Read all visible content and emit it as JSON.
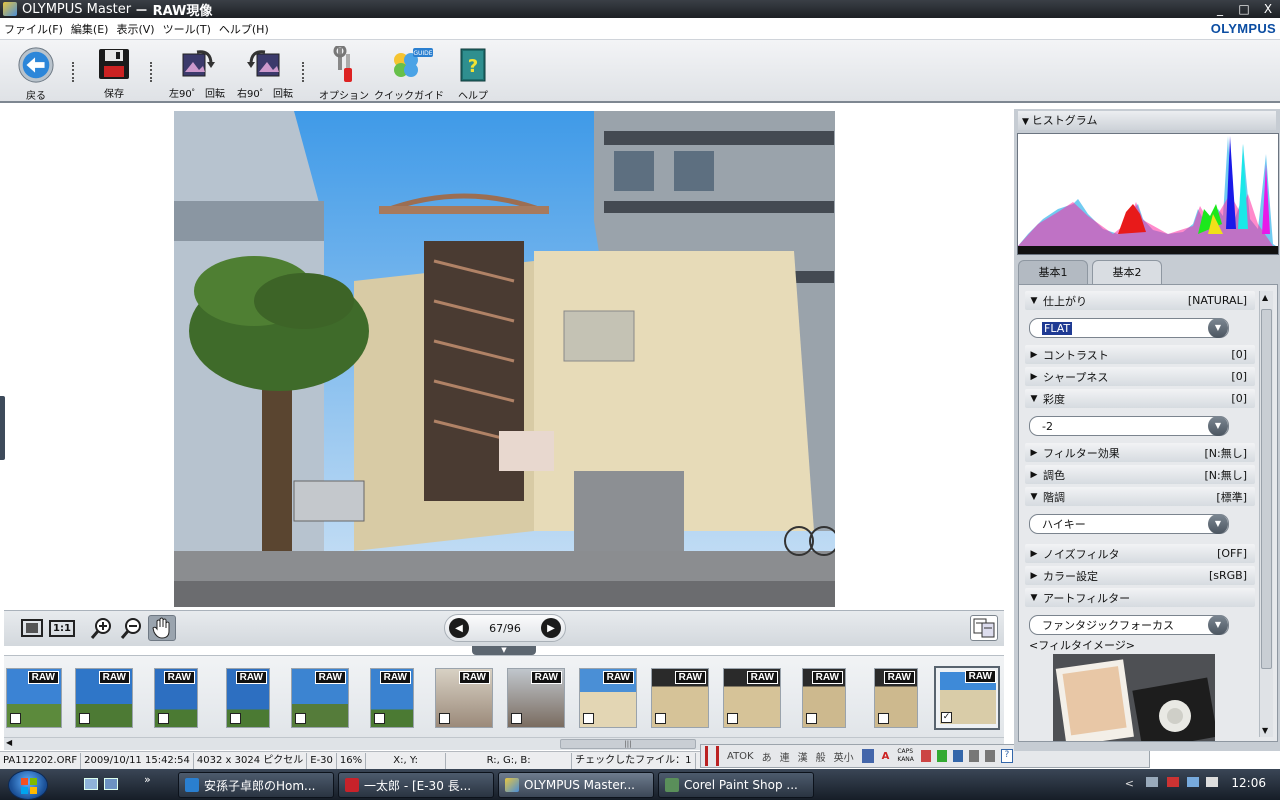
{
  "window": {
    "title": "OLYMPUS Master",
    "subtitle": "－ RAW現像",
    "controls": [
      "_",
      "□",
      "X"
    ]
  },
  "menu": {
    "items": [
      "ファイル(F)",
      "編集(E)",
      "表示(V)",
      "ツール(T)",
      "ヘルプ(H)"
    ],
    "brand": "OLYMPUS"
  },
  "toolbar": {
    "back": "戻る",
    "save": "保存",
    "rotate_left": "左90゜ 回転",
    "rotate_right": "右90゜ 回転",
    "options": "オプション",
    "quick_guide": "クイックガイド",
    "quick_guide_badge": "GUIDE",
    "help": "ヘルプ"
  },
  "viewbar": {
    "page_counter": "67/96",
    "ratio_label": "1:1"
  },
  "filmstrip": {
    "badge": "RAW",
    "thumbs": [
      {
        "checked": false
      },
      {
        "checked": false
      },
      {
        "checked": false
      },
      {
        "checked": false
      },
      {
        "checked": false
      },
      {
        "checked": false
      },
      {
        "checked": false
      },
      {
        "checked": false
      },
      {
        "checked": false
      },
      {
        "checked": false
      },
      {
        "checked": false
      },
      {
        "checked": false
      },
      {
        "checked": false
      },
      {
        "checked": true
      }
    ]
  },
  "status": {
    "filename": "PA112202.ORF",
    "datetime": "2009/10/11 15:42:54",
    "dimensions": "4032 x 3024 ピクセル",
    "camera": "E-30",
    "zoom": "16%",
    "xy": "X:, Y:",
    "rgb": "R:, G:, B:",
    "checked_files": "チェックしたファイル：1"
  },
  "ime": {
    "atok": "ATOK",
    "keys": [
      "あ",
      "連",
      "漢",
      "般",
      "英小"
    ],
    "caps": "CAPS",
    "kana": "KANA"
  },
  "panel": {
    "histogram_title": "ヒストグラム",
    "tabs": [
      "基本1",
      "基本2"
    ],
    "active_tab": 1,
    "finish": {
      "label": "仕上がり",
      "value": "[NATURAL]",
      "selected": "FLAT"
    },
    "contrast": {
      "label": "コントラスト",
      "value": "[0]"
    },
    "sharpness": {
      "label": "シャープネス",
      "value": "[0]"
    },
    "saturation": {
      "label": "彩度",
      "value": "[0]",
      "selected": "-2"
    },
    "filter": {
      "label": "フィルター効果",
      "value": "[N:無し]"
    },
    "tone": {
      "label": "調色",
      "value": "[N:無し]"
    },
    "gradation": {
      "label": "階調",
      "value": "[標準]",
      "selected": "ハイキー"
    },
    "noise": {
      "label": "ノイズフィルタ",
      "value": "[OFF]"
    },
    "color_space": {
      "label": "カラー設定",
      "value": "[sRGB]"
    },
    "art_filter": {
      "label": "アートフィルター",
      "selected": "ファンタジックフォーカス",
      "caption": "<フィルタイメージ>"
    }
  },
  "taskbar": {
    "buttons": [
      "安孫子卓郎のHom...",
      "一太郎 - [E-30 長...",
      "OLYMPUS Master...",
      "Corel Paint Shop ..."
    ],
    "clock": "12:06",
    "tray_chevron": "<"
  },
  "colors": {
    "title_bar": "#2a2e34",
    "brand_blue": "#0b4da2",
    "selection": "#1f3a93",
    "panel_bg": "#c6ccd3"
  }
}
